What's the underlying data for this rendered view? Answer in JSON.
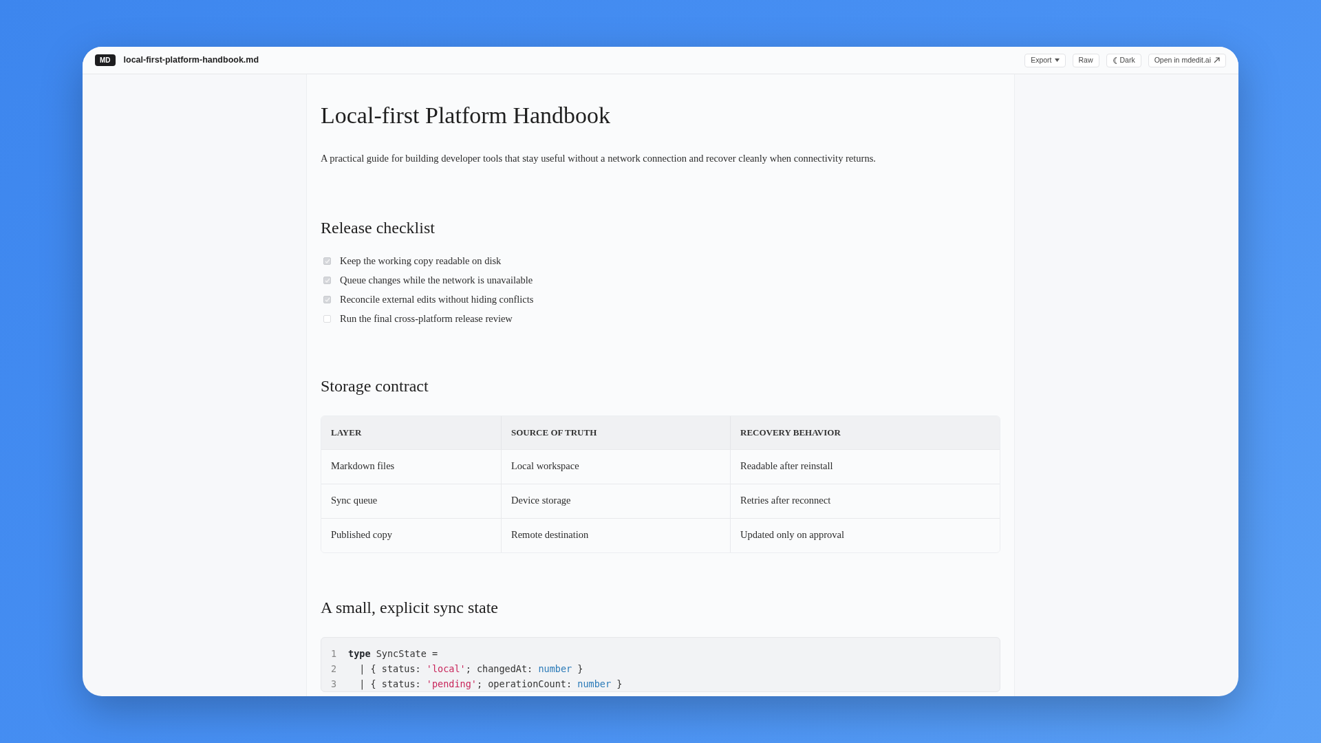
{
  "toolbar": {
    "badge": "MD",
    "filename": "local-first-platform-handbook.md",
    "buttons": [
      {
        "label": "Export",
        "kind": "dropdown"
      },
      {
        "label": "Raw",
        "kind": "plain"
      },
      {
        "label": "Dark",
        "kind": "theme"
      },
      {
        "label": "Open in mdedit.ai",
        "kind": "external"
      }
    ]
  },
  "document": {
    "title": "Local-first Platform Handbook",
    "intro": "A practical guide for building developer tools that stay useful without a network connection and recover cleanly when connectivity returns.",
    "checklist": {
      "heading": "Release checklist",
      "items": [
        {
          "label": "Keep the working copy readable on disk",
          "checked": true
        },
        {
          "label": "Queue changes while the network is unavailable",
          "checked": true
        },
        {
          "label": "Reconcile external edits without hiding conflicts",
          "checked": true
        },
        {
          "label": "Run the final cross-platform release review",
          "checked": false
        }
      ]
    },
    "table": {
      "heading": "Storage contract",
      "columns": [
        "LAYER",
        "SOURCE OF TRUTH",
        "RECOVERY BEHAVIOR"
      ],
      "rows": [
        [
          "Markdown files",
          "Local workspace",
          "Readable after reinstall"
        ],
        [
          "Sync queue",
          "Device storage",
          "Retries after reconnect"
        ],
        [
          "Published copy",
          "Remote destination",
          "Updated only on approval"
        ]
      ]
    },
    "code": {
      "heading": "A small, explicit sync state",
      "lines": [
        {
          "number": "1",
          "tokens": [
            {
              "text": "type",
              "kind": "keyword"
            },
            {
              "text": " SyncState =",
              "kind": "plain"
            }
          ]
        },
        {
          "number": "2",
          "tokens": [
            {
              "text": "  | { status: ",
              "kind": "plain"
            },
            {
              "text": "'local'",
              "kind": "string"
            },
            {
              "text": "; changedAt: ",
              "kind": "plain"
            },
            {
              "text": "number",
              "kind": "type"
            },
            {
              "text": " }",
              "kind": "plain"
            }
          ]
        },
        {
          "number": "3",
          "tokens": [
            {
              "text": "  | { status: ",
              "kind": "plain"
            },
            {
              "text": "'pending'",
              "kind": "string"
            },
            {
              "text": "; operationCount: ",
              "kind": "plain"
            },
            {
              "text": "number",
              "kind": "type"
            },
            {
              "text": " }",
              "kind": "plain"
            }
          ]
        }
      ]
    }
  }
}
